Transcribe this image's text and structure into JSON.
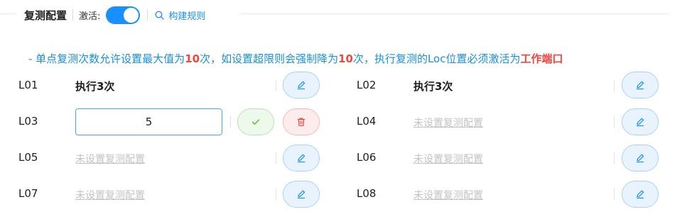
{
  "header": {
    "title": "复测配置",
    "active_label": "激活:",
    "active": true,
    "rules_link": "构建规则"
  },
  "notice": {
    "part1": "- 单点复测次数允许设置最大值为",
    "max1": "10",
    "part2": "次，如设置超限则会强制降为",
    "max2": "10",
    "part3": "次，执行复测的Loc位置必须激活为",
    "port": "工作端口"
  },
  "rows": {
    "L01": {
      "label": "L01",
      "value": "执行3次"
    },
    "L02": {
      "label": "L02",
      "value": "执行3次"
    },
    "L03": {
      "label": "L03",
      "input_value": "5"
    },
    "L04": {
      "label": "L04",
      "value": "未设置复测配置"
    },
    "L05": {
      "label": "L05",
      "value": "未设置复测配置"
    },
    "L06": {
      "label": "L06",
      "value": "未设置复测配置"
    },
    "L07": {
      "label": "L07",
      "value": "未设置复测配置"
    },
    "L08": {
      "label": "L08",
      "value": "未设置复测配置"
    }
  },
  "icons": {
    "edit": "pencil-icon",
    "confirm": "check-icon",
    "delete": "trash-icon",
    "rules": "search-icon"
  },
  "colors": {
    "accent": "#1890ff",
    "notice": "#1a8fe0",
    "highlight": "#f5453c",
    "empty_text": "#c3c3c3"
  }
}
